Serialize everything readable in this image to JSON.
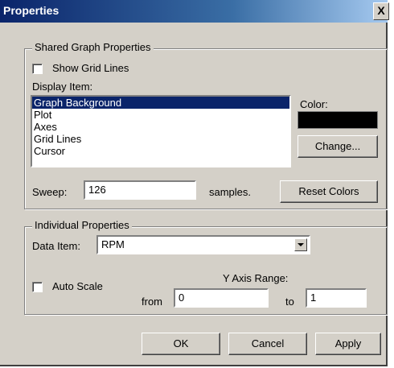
{
  "window": {
    "title": "Properties",
    "close_label": "X"
  },
  "shared": {
    "group_label": "Shared Graph Properties",
    "show_grid_lines_label": "Show Grid Lines",
    "show_grid_lines_checked": false,
    "display_item_label": "Display Item:",
    "display_items": [
      {
        "label": "Graph Background",
        "selected": true
      },
      {
        "label": "Plot",
        "selected": false
      },
      {
        "label": "Axes",
        "selected": false
      },
      {
        "label": "Grid Lines",
        "selected": false
      },
      {
        "label": "Cursor",
        "selected": false
      }
    ],
    "color_label": "Color:",
    "color_value": "#000000",
    "change_button": "Change...",
    "sweep_label": "Sweep:",
    "sweep_value": "126",
    "samples_label": "samples.",
    "reset_colors_button": "Reset Colors"
  },
  "individual": {
    "group_label": "Individual Properties",
    "data_item_label": "Data Item:",
    "data_item_value": "RPM",
    "auto_scale_label": "Auto Scale",
    "auto_scale_checked": false,
    "y_axis_range_label": "Y Axis Range:",
    "from_label": "from",
    "from_value": "0",
    "to_label": "to",
    "to_value": "1"
  },
  "footer": {
    "ok_button": "OK",
    "cancel_button": "Cancel",
    "apply_button": "Apply"
  }
}
